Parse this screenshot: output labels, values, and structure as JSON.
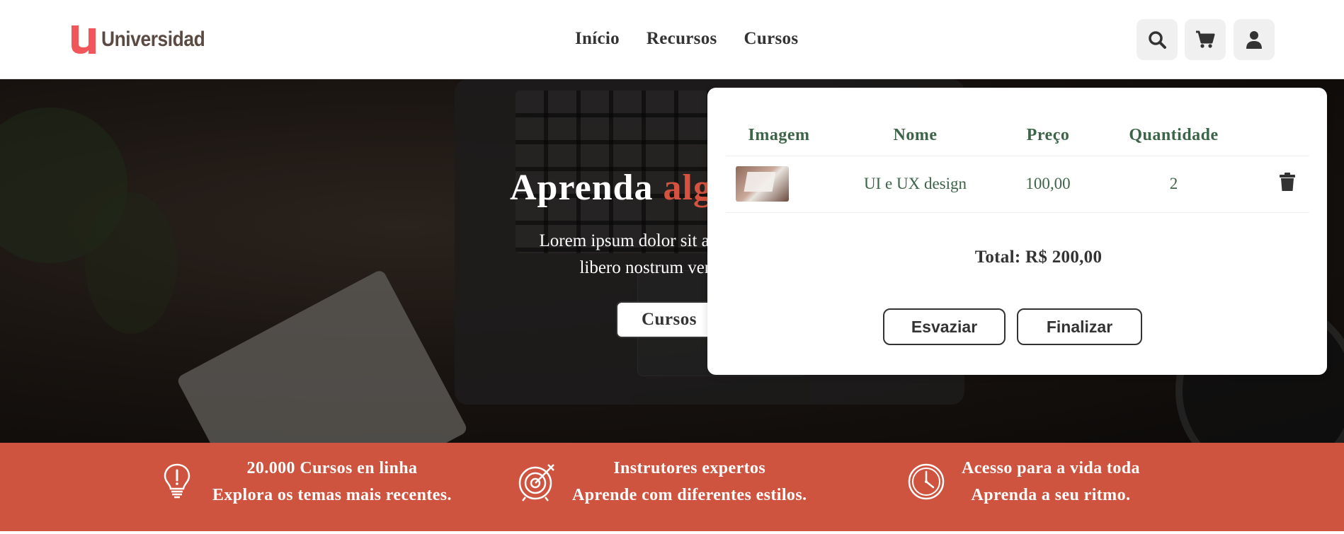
{
  "header": {
    "logo_text": "Universidad",
    "nav": [
      {
        "label": "Início"
      },
      {
        "label": "Recursos"
      },
      {
        "label": "Cursos"
      }
    ],
    "icons": [
      "search-icon",
      "cart-icon",
      "user-icon"
    ]
  },
  "hero": {
    "title": "Aprenda",
    "title_accent": "alg",
    "text_line1": "Lorem ipsum dolor sit amet consectet",
    "text_line2": "libero nostrum veniam fac",
    "button": "Cursos"
  },
  "features": [
    {
      "icon": "lightbulb-icon",
      "title": "20.000 Cursos en linha",
      "subtitle": "Explora os temas mais recentes."
    },
    {
      "icon": "target-icon",
      "title": "Instrutores expertos",
      "subtitle": "Aprende com diferentes estilos."
    },
    {
      "icon": "clock-icon",
      "title": "Acesso para a vida toda",
      "subtitle": "Aprenda a seu ritmo."
    }
  ],
  "cart": {
    "headers": {
      "image": "Imagem",
      "name": "Nome",
      "price": "Preço",
      "quantity": "Quantidade"
    },
    "items": [
      {
        "name": "UI e UX design",
        "price": "100,00",
        "quantity": "2"
      }
    ],
    "total": "Total: R$ 200,00",
    "empty_button": "Esvaziar",
    "checkout_button": "Finalizar"
  },
  "colors": {
    "brand": "#cf5440",
    "accent_text": "#d4523f",
    "cart_text": "#3d6349",
    "logo_text": "#5a4a42"
  }
}
